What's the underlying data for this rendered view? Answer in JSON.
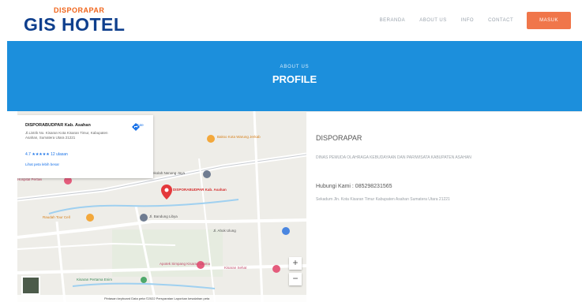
{
  "header": {
    "logo_top": "DISPORAPAR",
    "logo_main": "GIS HOTEL",
    "nav": [
      "BERANDA",
      "ABOUT US",
      "INFO",
      "CONTACT"
    ],
    "cta": "MASUK"
  },
  "hero": {
    "subtitle": "ABOUT US",
    "title": "PROFILE"
  },
  "map": {
    "card": {
      "title": "DISPORABUDPAR Kab. Asahan",
      "address": "Jl.Listrik No. Kisaran Kota Kisaran Timur, Kabupaten Asahan, Sumatera Utara 21221",
      "rating": "4.7 ★★★★★  12 ulasan",
      "link": "Lihat peta lebih besar",
      "directions": "Rute"
    },
    "labels": {
      "hotel": "Bakso Kota Warung Jerkab",
      "school": "Sekolah Nenong Jaya",
      "pin": "DISPORABUDPAR Kab. Asahan",
      "hospital": "Hospital Pertiwi",
      "mosque": "Masjid Al-Huda",
      "street1": "Jl. Bandung Libya",
      "street2": "Jl. Ahok Ulung",
      "place1": "Raudah Tour Cell",
      "place2": "Apotek Simpang Kisaran Utama",
      "place3": "Kisaran Sehat",
      "place4": "Kisaran Pertama Enim",
      "bottom": "Kisaran Pertama Enim"
    },
    "zoom_in": "+",
    "zoom_out": "−",
    "footer": "Pintasan keyboard   Data peta ©2022   Persyaratan   Laporkan kesalahan peta"
  },
  "info": {
    "name": "DISPORAPAR",
    "description": "DINAS PEMUDA OLAHRAGA KEBUDAYAAN DAN PARIWISATA KABUPATEN ASAHAN",
    "contact": "Hubungi Kami : 085298231565",
    "address": "Sekadum Jln. Kota Kisaran Timur Kabupaten Asahan Sumatera Utara 21221"
  },
  "colors": {
    "brand_blue": "#1c8fdc",
    "logo_navy": "#0f3f8d",
    "accent_orange": "#f0764a"
  }
}
